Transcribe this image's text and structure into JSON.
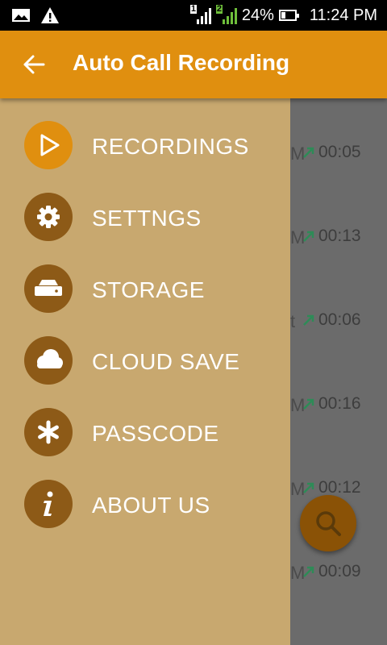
{
  "status_bar": {
    "sim1": "1",
    "sim2": "2",
    "battery": "24%",
    "time": "11:24 PM",
    "icons": [
      "image-icon",
      "warning-icon",
      "signal-icon",
      "battery-icon"
    ]
  },
  "app_bar": {
    "title": "Auto Call Recording",
    "color": "#e08f0f"
  },
  "drawer": {
    "items": [
      {
        "label": "RECORDINGS",
        "icon": "play-icon",
        "active": true
      },
      {
        "label": "SETTNGS",
        "icon": "gear-icon",
        "active": false
      },
      {
        "label": "STORAGE",
        "icon": "drive-icon",
        "active": false
      },
      {
        "label": "CLOUD SAVE",
        "icon": "cloud-icon",
        "active": false
      },
      {
        "label": "PASSCODE",
        "icon": "asterisk-icon",
        "active": false
      },
      {
        "label": "ABOUT US",
        "icon": "info-icon",
        "active": false
      }
    ]
  },
  "background_list": {
    "rows": [
      {
        "fragment": "M",
        "duration": "00:05"
      },
      {
        "fragment": "M",
        "duration": "00:13"
      },
      {
        "fragment": "t",
        "duration": "00:06"
      },
      {
        "fragment": "M",
        "duration": "00:16"
      },
      {
        "fragment": "M",
        "duration": "00:12"
      },
      {
        "fragment": "M",
        "duration": "00:09"
      }
    ]
  },
  "fab": {
    "icon": "search-icon"
  }
}
